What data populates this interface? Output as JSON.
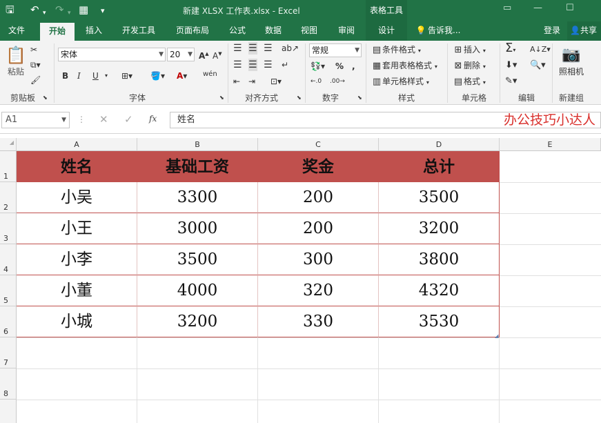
{
  "window": {
    "title": "新建 XLSX 工作表.xlsx - Excel",
    "context_tab": "表格工具"
  },
  "tabs": [
    {
      "label": "文件"
    },
    {
      "label": "开始",
      "active": true
    },
    {
      "label": "插入"
    },
    {
      "label": "开发工具"
    },
    {
      "label": "页面布局"
    },
    {
      "label": "公式"
    },
    {
      "label": "数据"
    },
    {
      "label": "视图"
    },
    {
      "label": "审阅"
    },
    {
      "label": "设计"
    },
    {
      "label": "告诉我..."
    }
  ],
  "account": {
    "login": "登录",
    "share": "共享"
  },
  "ribbon": {
    "clipboard": {
      "label": "剪贴板",
      "paste": "粘贴"
    },
    "font": {
      "label": "字体",
      "font_name": "宋体",
      "font_size": "20",
      "phonetic": "wén"
    },
    "alignment": {
      "label": "对齐方式"
    },
    "number": {
      "label": "数字",
      "format": "常规"
    },
    "styles": {
      "label": "样式",
      "conditional": "条件格式",
      "table_format": "套用表格格式",
      "cell_styles": "单元格样式"
    },
    "cells": {
      "label": "单元格",
      "insert": "插入",
      "delete": "删除",
      "format": "格式"
    },
    "editing": {
      "label": "编辑"
    },
    "new_group": {
      "label": "新建组",
      "camera": "照相机"
    }
  },
  "formula_bar": {
    "name_box": "A1",
    "content": "姓名",
    "fx": "fx",
    "watermark": "办公技巧小达人"
  },
  "columns": [
    "A",
    "B",
    "C",
    "D",
    "E"
  ],
  "rows": [
    "1",
    "2",
    "3",
    "4",
    "5",
    "6",
    "7",
    "8"
  ],
  "table": {
    "headers": [
      "姓名",
      "基础工资",
      "奖金",
      "总计"
    ],
    "rows": [
      [
        "小吴",
        "3300",
        "200",
        "3500"
      ],
      [
        "小王",
        "3000",
        "200",
        "3200"
      ],
      [
        "小李",
        "3500",
        "300",
        "3800"
      ],
      [
        "小董",
        "4000",
        "320",
        "4320"
      ],
      [
        "小城",
        "3200",
        "330",
        "3530"
      ]
    ]
  },
  "colors": {
    "excel_green": "#217346",
    "table_header": "#c0504d",
    "watermark": "#d9302c"
  }
}
